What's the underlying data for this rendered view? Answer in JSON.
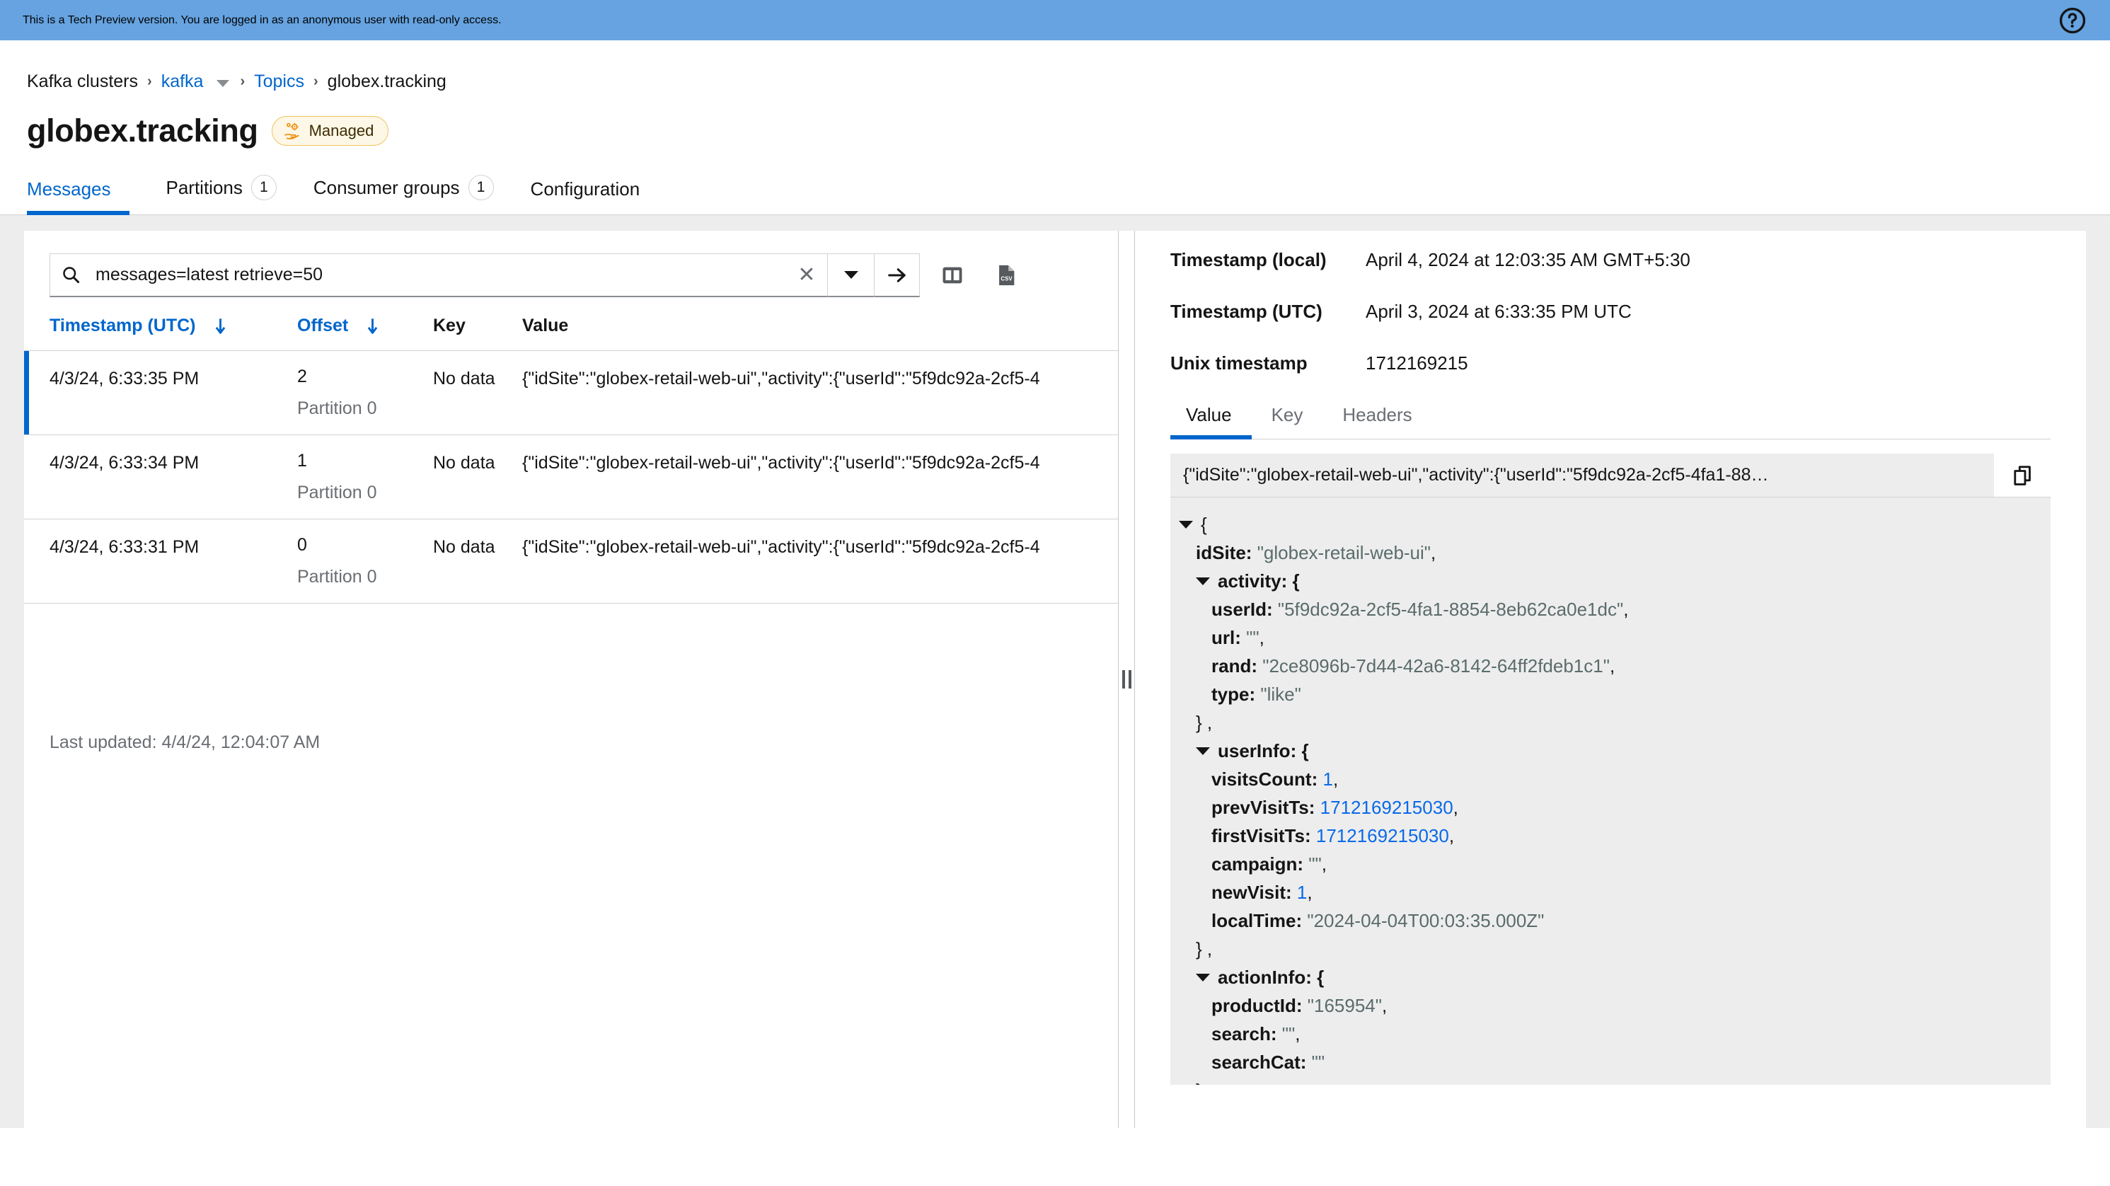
{
  "banner": {
    "message": "This is a Tech Preview version. You are logged in as an anonymous user with read-only access.",
    "help_icon": "help-circle-icon",
    "bg_color": "#66a3e0"
  },
  "breadcrumb": {
    "items": [
      {
        "label": "Kafka clusters",
        "link": false
      },
      {
        "label": "kafka",
        "link": true,
        "has_caret": true
      },
      {
        "label": "Topics",
        "link": true
      },
      {
        "label": "globex.tracking",
        "link": false
      }
    ],
    "separator": "›"
  },
  "header": {
    "title": "globex.tracking",
    "badge": {
      "label": "Managed",
      "icon": "managed-gear-hand-icon",
      "color": "#f0c35c"
    }
  },
  "tabs": [
    {
      "label": "Messages",
      "count": null,
      "active": true
    },
    {
      "label": "Partitions",
      "count": "1",
      "active": false
    },
    {
      "label": "Consumer groups",
      "count": "1",
      "active": false
    },
    {
      "label": "Configuration",
      "count": null,
      "active": false
    }
  ],
  "search": {
    "value": "messages=latest retrieve=50",
    "placeholder": "messages=latest retrieve=50",
    "search_icon": "search-icon",
    "clear_icon": "close-x-icon",
    "dropdown_icon": "chevron-down-icon",
    "submit_icon": "arrow-right-icon",
    "layout_icon": "two-column-layout-icon",
    "export_icon": "csv-file-icon"
  },
  "table": {
    "columns": [
      {
        "label": "Timestamp (UTC)",
        "sortable": true
      },
      {
        "label": "Offset",
        "sortable": true
      },
      {
        "label": "Key",
        "sortable": false
      },
      {
        "label": "Value",
        "sortable": false
      }
    ],
    "rows": [
      {
        "timestamp": "4/3/24, 6:33:35 PM",
        "offset": "2",
        "partition": "Partition 0",
        "key": "No data",
        "value": "{\"idSite\":\"globex-retail-web-ui\",\"activity\":{\"userId\":\"5f9dc92a-2cf5-4",
        "selected": true
      },
      {
        "timestamp": "4/3/24, 6:33:34 PM",
        "offset": "1",
        "partition": "Partition 0",
        "key": "No data",
        "value": "{\"idSite\":\"globex-retail-web-ui\",\"activity\":{\"userId\":\"5f9dc92a-2cf5-4",
        "selected": false
      },
      {
        "timestamp": "4/3/24, 6:33:31 PM",
        "offset": "0",
        "partition": "Partition 0",
        "key": "No data",
        "value": "{\"idSite\":\"globex-retail-web-ui\",\"activity\":{\"userId\":\"5f9dc92a-2cf5-4",
        "selected": false
      }
    ],
    "last_updated": "Last updated: 4/4/24, 12:04:07 AM"
  },
  "detail": {
    "meta": [
      {
        "label": "Timestamp (local)",
        "value": "April 4, 2024 at 12:03:35 AM GMT+5:30"
      },
      {
        "label": "Timestamp (UTC)",
        "value": "April 3, 2024 at 6:33:35 PM UTC"
      },
      {
        "label": "Unix timestamp",
        "value": "1712169215"
      }
    ],
    "tabs": [
      {
        "label": "Value",
        "active": true
      },
      {
        "label": "Key",
        "active": false
      },
      {
        "label": "Headers",
        "active": false
      }
    ],
    "copy_bar": {
      "text": "{\"idSite\":\"globex-retail-web-ui\",\"activity\":{\"userId\":\"5f9dc92a-2cf5-4fa1-88…",
      "copy_icon": "copy-icon"
    },
    "json": {
      "open_brace": "{",
      "close_brace": "}",
      "l_idSite_key": "idSite:",
      "l_idSite_val": "\"globex-retail-web-ui\"",
      "l_activity_key": "activity: {",
      "l_userId_key": "userId:",
      "l_userId_val": "\"5f9dc92a-2cf5-4fa1-8854-8eb62ca0e1dc\"",
      "l_url_key": "url:",
      "l_url_val": "\"\"",
      "l_rand_key": "rand:",
      "l_rand_val": "\"2ce8096b-7d44-42a6-8142-64ff2fdeb1c1\"",
      "l_type_key": "type:",
      "l_type_val": "\"like\"",
      "close_comma": "} ,",
      "l_userInfo_key": "userInfo: {",
      "l_visitsCount_key": "visitsCount:",
      "l_visitsCount_val": "1",
      "l_prevVisitTs_key": "prevVisitTs:",
      "l_prevVisitTs_val": "1712169215030",
      "l_firstVisitTs_key": "firstVisitTs:",
      "l_firstVisitTs_val": "1712169215030",
      "l_campaign_key": "campaign:",
      "l_campaign_val": "\"\"",
      "l_newVisit_key": "newVisit:",
      "l_newVisit_val": "1",
      "l_localTime_key": "localTime:",
      "l_localTime_val": "\"2024-04-04T00:03:35.000Z\"",
      "l_actionInfo_key": "actionInfo: {",
      "l_productId_key": "productId:",
      "l_productId_val": "\"165954\"",
      "l_search_key": "search:",
      "l_search_val": "\"\"",
      "l_searchCat_key": "searchCat:",
      "l_searchCat_val": "\"\"",
      "comma": ",",
      "close_inner": "}",
      "close_outer": "}"
    }
  }
}
